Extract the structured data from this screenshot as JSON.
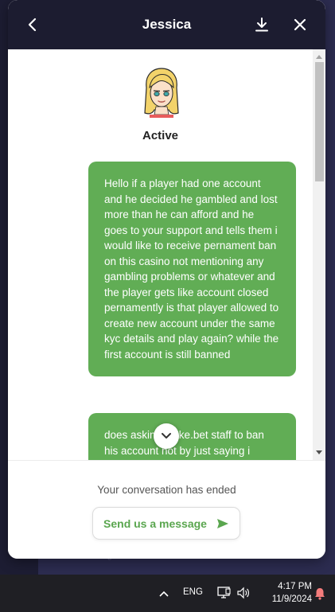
{
  "header": {
    "title": "Jessica",
    "back_icon": "chevron-left-icon",
    "download_icon": "download-icon",
    "close_icon": "close-icon"
  },
  "agent": {
    "status": "Active"
  },
  "messages": [
    {
      "sender": "user",
      "text": "Hello if a player had one account and he decided he gambled and lost more than he can afford and he goes to your support and tells them i would like to receive pernament ban on this casino not mentioning any gambling problems or whatever and the player gets like account closed pernamently is that player allowed to create new account under the same kyc details and play again? while the first account is still banned"
    },
    {
      "sender": "user",
      "text": "does asking stake.bet staff to ban his account not by just saying i would"
    }
  ],
  "footer": {
    "ended_text": "Your conversation has ended",
    "send_label": "Send us a message"
  },
  "colors": {
    "header_bg": "#1c1c30",
    "bubble_bg": "#61ad55",
    "accent_green": "#5aa64f"
  },
  "taskbar": {
    "language": "ENG",
    "time": "4:17 PM",
    "date": "11/9/2024"
  }
}
